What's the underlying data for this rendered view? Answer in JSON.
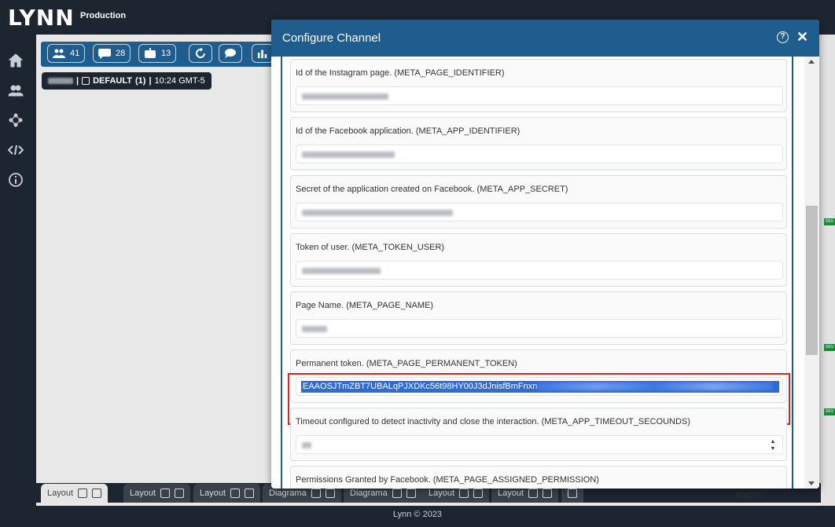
{
  "app": {
    "logo": "LYNN",
    "environment": "Production"
  },
  "sidebar": {
    "icons": [
      "home-icon",
      "users-icon",
      "flow-icon",
      "code-icon",
      "info-icon"
    ]
  },
  "toolbar": {
    "agents_count": "41",
    "conversations_count": "28",
    "bots_count": "13"
  },
  "status": {
    "queue": "DEFAULT",
    "queue_count": "(1)",
    "time": "10:24 GMT-5",
    "separator": "|"
  },
  "modal": {
    "title": "Configure Channel",
    "help_label": "?",
    "close_label": "✕",
    "fields": [
      {
        "label": "Id of the Instagram page. (META_PAGE_IDENTIFIER)"
      },
      {
        "label": "Id of the Facebook application. (META_APP_IDENTIFIER)"
      },
      {
        "label": "Secret of the application created on Facebook. (META_APP_SECRET)"
      },
      {
        "label": "Token of user. (META_TOKEN_USER)"
      },
      {
        "label": "Page Name. (META_PAGE_NAME)"
      },
      {
        "label": "Permanent token. (META_PAGE_PERMANENT_TOKEN)",
        "value": "EAAOSJTmZBT7UBALqPJXDKc56t98HY00J3dJnisfBmFnxn"
      },
      {
        "label": "Timeout configured to detect inactivity and close the interaction. (META_APP_TIMEOUT_SECOUNDS)"
      },
      {
        "label": "Permissions Granted by Facebook. (META_PAGE_ASSIGNED_PERMISSION)"
      }
    ]
  },
  "bottom_tabs": [
    "Layout",
    "Layout",
    "Layout",
    "Diagrama",
    "Diagrama",
    "Layout",
    "Layout"
  ],
  "inicio_label": "INICIO",
  "dev_badge": "DEV",
  "footer": "Lynn © 2023",
  "colors": {
    "primary": "#1f5d8f",
    "dark": "#1d2530",
    "highlight": "#cc2a2a",
    "selection": "#2f6bd8"
  }
}
